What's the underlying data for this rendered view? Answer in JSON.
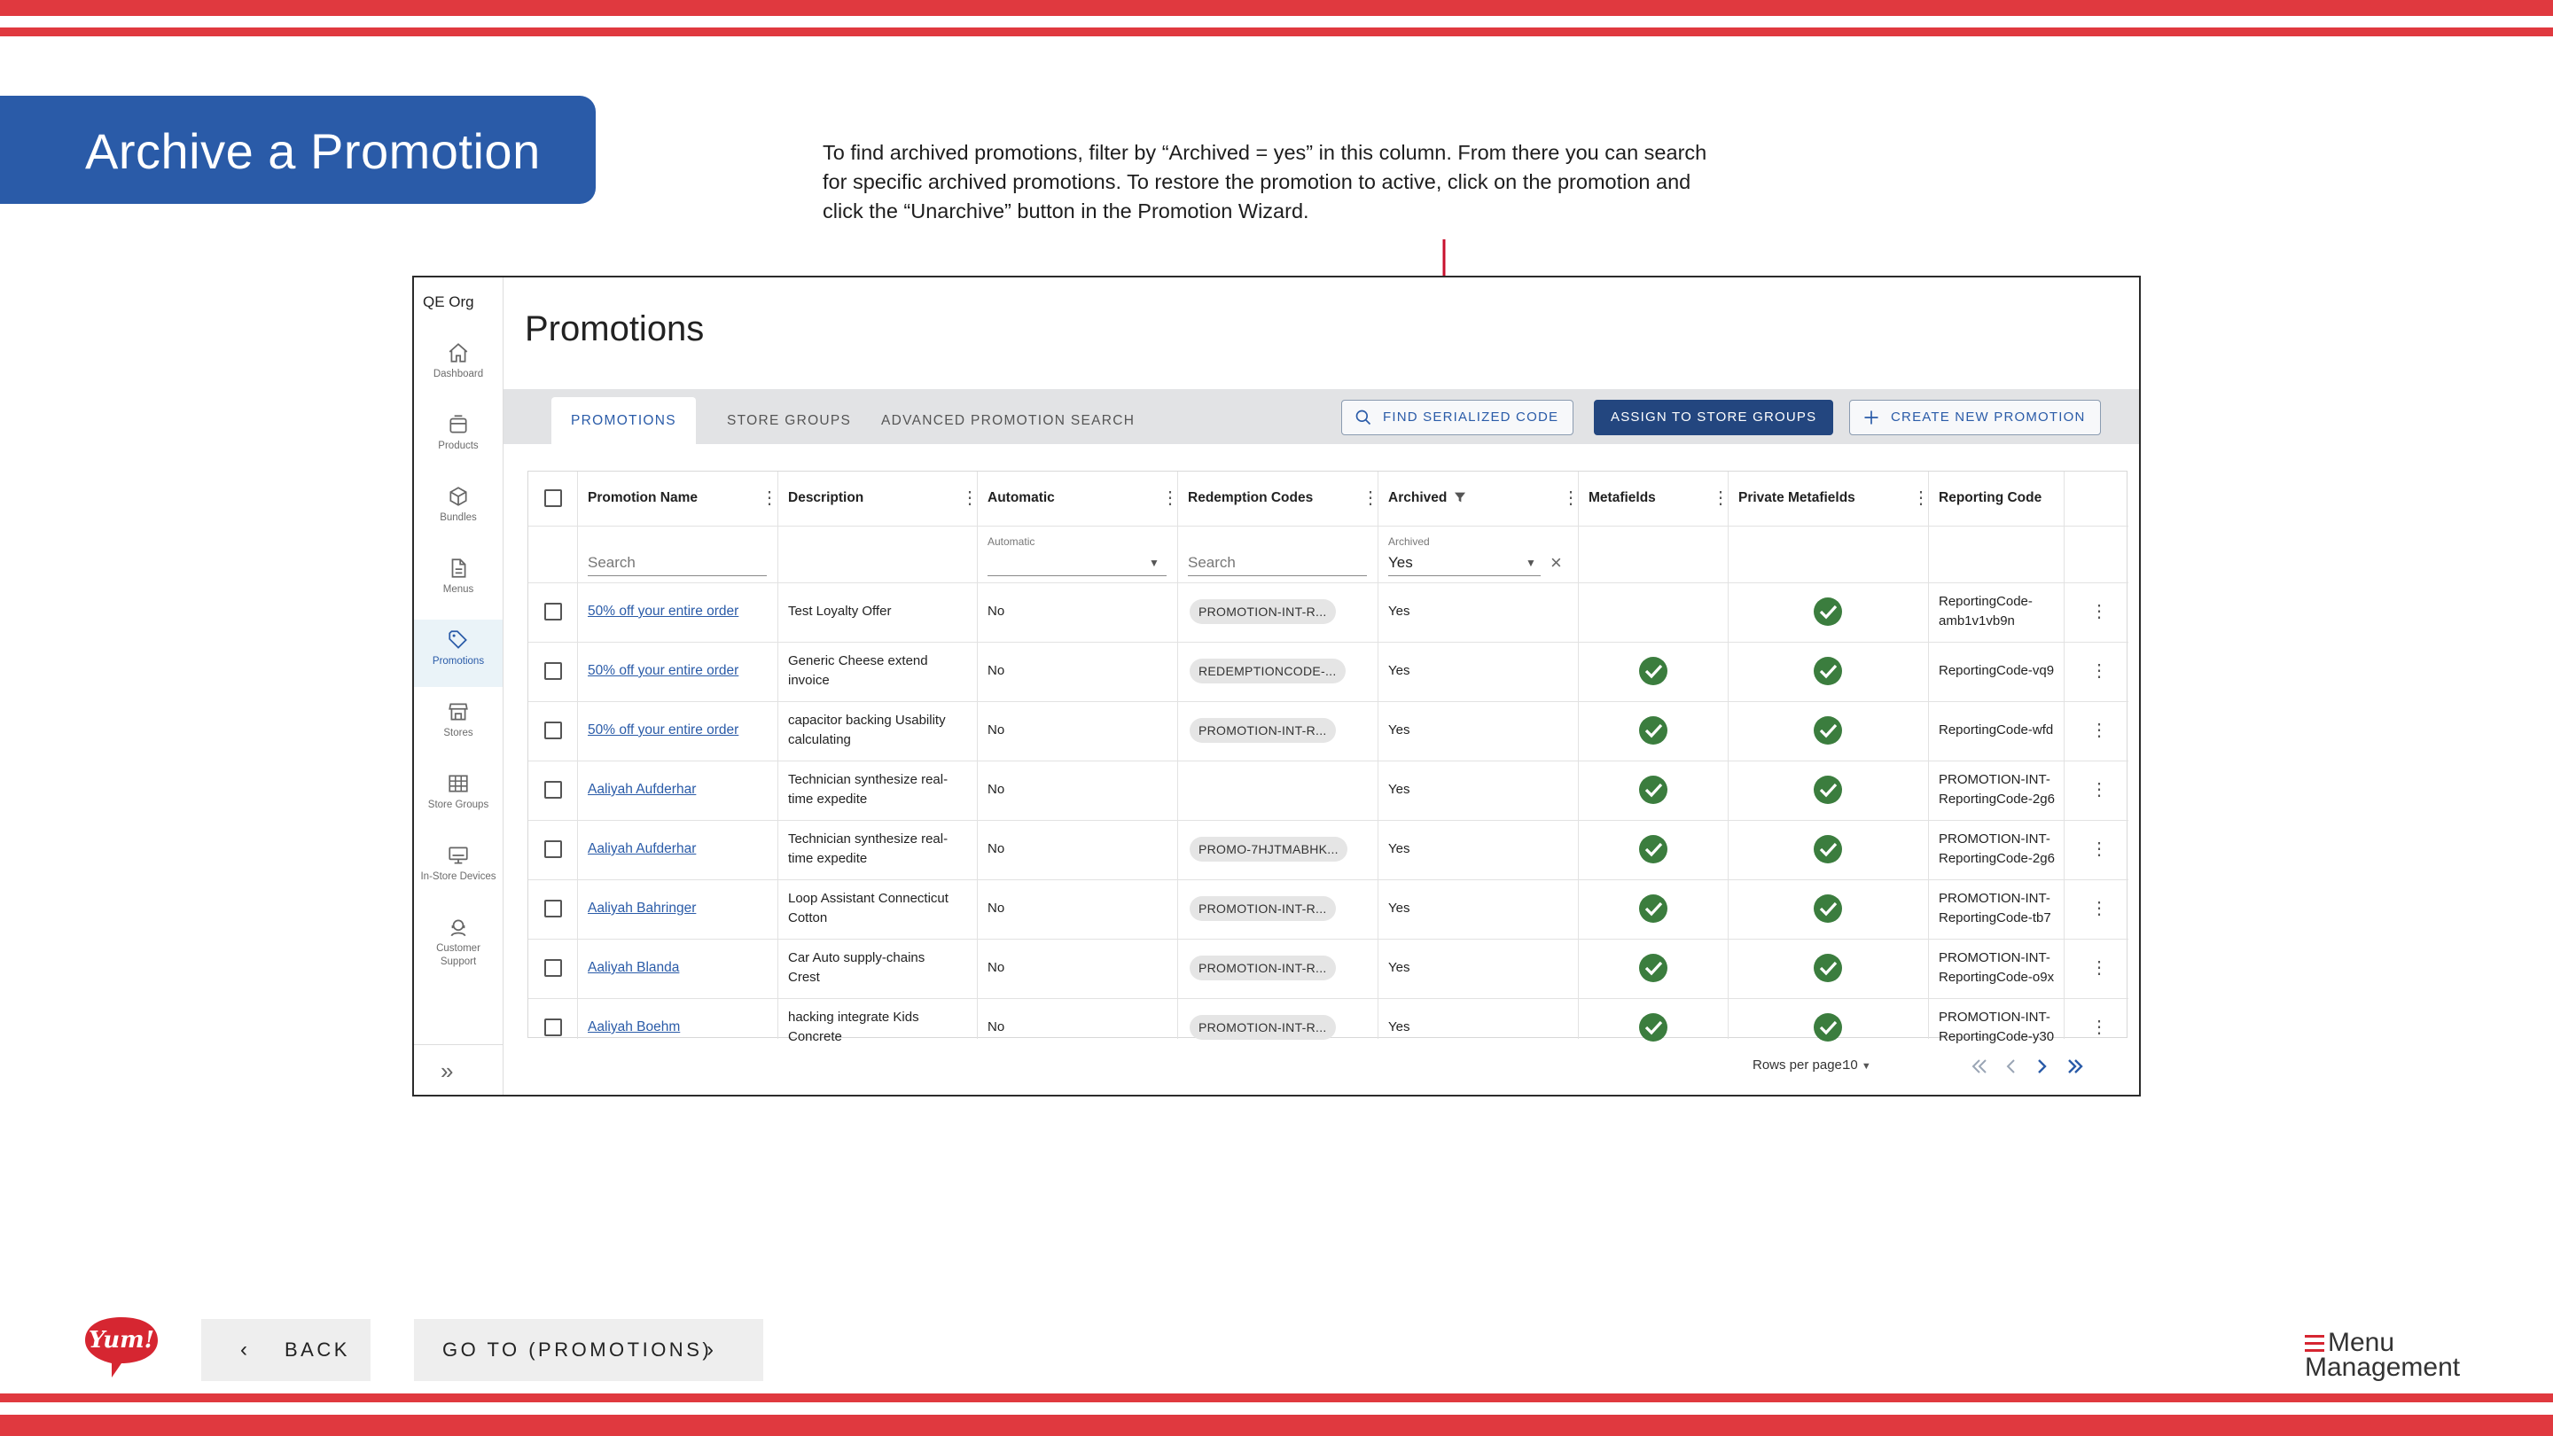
{
  "slide": {
    "title": "Archive a Promotion",
    "callout": "To find archived promotions, filter by “Archived = yes” in this column. From there you can search for specific archived promotions. To restore the promotion to active, click on the promotion and click the “Unarchive” button in the Promotion Wizard.",
    "back_label": "BACK",
    "go_label": "GO TO (PROMOTIONS)",
    "brand_logo": "Yum!",
    "menu_logo_line1": "Menu",
    "menu_logo_line2": "Management",
    "accent_color": "#e0393f",
    "banner_color": "#2a5ba8"
  },
  "app": {
    "org": "QE Org",
    "page_title": "Promotions",
    "sidebar": [
      {
        "label": "Dashboard",
        "icon": "home-icon"
      },
      {
        "label": "Products",
        "icon": "box-icon"
      },
      {
        "label": "Bundles",
        "icon": "cube-icon"
      },
      {
        "label": "Menus",
        "icon": "document-icon"
      },
      {
        "label": "Promotions",
        "icon": "tag-icon",
        "active": true
      },
      {
        "label": "Stores",
        "icon": "store-icon"
      },
      {
        "label": "Store Groups",
        "icon": "grid-icon"
      },
      {
        "label": "In-Store Devices",
        "icon": "monitor-icon"
      },
      {
        "label": "Customer Support",
        "icon": "headset-icon"
      }
    ],
    "tabs": [
      "PROMOTIONS",
      "STORE GROUPS",
      "ADVANCED PROMOTION SEARCH"
    ],
    "buttons": {
      "find": "FIND SERIALIZED CODE",
      "assign": "ASSIGN TO STORE GROUPS",
      "create": "CREATE NEW PROMOTION"
    },
    "columns": [
      "Promotion Name",
      "Description",
      "Automatic",
      "Redemption Codes",
      "Archived",
      "Metafields",
      "Private Metafields",
      "Reporting Code"
    ],
    "filters": {
      "name_placeholder": "Search",
      "automatic_label": "Automatic",
      "codes_placeholder": "Search",
      "archived_label": "Archived",
      "archived_value": "Yes"
    },
    "rows": [
      {
        "name": "50% off your entire order",
        "desc1": "Test Loyalty Offer",
        "desc2": "",
        "automatic": "No",
        "code": "PROMOTION-INT-R...",
        "archived": "Yes",
        "meta": false,
        "private": true,
        "rep1": "ReportingCode-",
        "rep2": "amb1v1vb9n"
      },
      {
        "name": "50% off your entire order",
        "desc1": "Generic Cheese extend",
        "desc2": "invoice",
        "automatic": "No",
        "code": "REDEMPTIONCODE-...",
        "archived": "Yes",
        "meta": true,
        "private": true,
        "rep1": "ReportingCode-vq9",
        "rep2": ""
      },
      {
        "name": "50% off your entire order",
        "desc1": "capacitor backing Usability",
        "desc2": "calculating",
        "automatic": "No",
        "code": "PROMOTION-INT-R...",
        "archived": "Yes",
        "meta": true,
        "private": true,
        "rep1": "ReportingCode-wfd",
        "rep2": ""
      },
      {
        "name": "Aaliyah Aufderhar",
        "desc1": "Technician synthesize real-",
        "desc2": "time expedite",
        "automatic": "No",
        "code": "",
        "archived": "Yes",
        "meta": true,
        "private": true,
        "rep1": "PROMOTION-INT-",
        "rep2": "ReportingCode-2g6"
      },
      {
        "name": "Aaliyah Aufderhar",
        "desc1": "Technician synthesize real-",
        "desc2": "time expedite",
        "automatic": "No",
        "code": "PROMO-7HJTMABHK...",
        "archived": "Yes",
        "meta": true,
        "private": true,
        "rep1": "PROMOTION-INT-",
        "rep2": "ReportingCode-2g6"
      },
      {
        "name": "Aaliyah Bahringer",
        "desc1": "Loop Assistant Connecticut",
        "desc2": "Cotton",
        "automatic": "No",
        "code": "PROMOTION-INT-R...",
        "archived": "Yes",
        "meta": true,
        "private": true,
        "rep1": "PROMOTION-INT-",
        "rep2": "ReportingCode-tb7"
      },
      {
        "name": "Aaliyah Blanda",
        "desc1": "Car Auto supply-chains",
        "desc2": "Crest",
        "automatic": "No",
        "code": "PROMOTION-INT-R...",
        "archived": "Yes",
        "meta": true,
        "private": true,
        "rep1": "PROMOTION-INT-",
        "rep2": "ReportingCode-o9x"
      },
      {
        "name": "Aaliyah Boehm",
        "desc1": "hacking integrate Kids",
        "desc2": "Concrete",
        "automatic": "No",
        "code": "PROMOTION-INT-R...",
        "archived": "Yes",
        "meta": true,
        "private": true,
        "rep1": "PROMOTION-INT-",
        "rep2": "ReportingCode-y30"
      }
    ],
    "pagination": {
      "rows_per_page_label": "Rows per page:",
      "rows_per_page_value": "10"
    }
  }
}
